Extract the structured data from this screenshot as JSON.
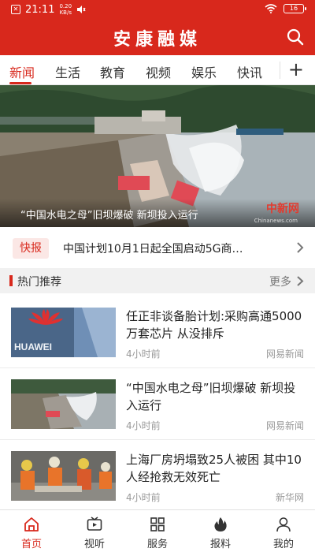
{
  "status_bar": {
    "time": "21:11",
    "net_speed_value": "0.20",
    "net_speed_unit": "KB/s",
    "battery": "16",
    "sim_icon": "sim-alert-icon",
    "icons": [
      "wifi-icon",
      "battery-icon",
      "mute-icon"
    ]
  },
  "header": {
    "title": "安康融媒",
    "search_icon": "search-icon",
    "color": "#d8281c"
  },
  "tabs": {
    "items": [
      {
        "label": "新闻",
        "active": true
      },
      {
        "label": "生活"
      },
      {
        "label": "教育"
      },
      {
        "label": "视频"
      },
      {
        "label": "娱乐"
      },
      {
        "label": "快讯"
      }
    ],
    "add_icon": "plus-icon"
  },
  "hero": {
    "caption": "“中国水电之母”旧坝爆破 新坝投入运行",
    "watermark": "中新网",
    "watermark_sub": "Chinanews.com"
  },
  "flash": {
    "badge": "快报",
    "text": "中国计划10月1日起全国启动5G商…"
  },
  "hot": {
    "title": "热门推荐",
    "more": "更多"
  },
  "news": [
    {
      "title": "任正非谈备胎计划:采购高通5000万套芯片 从没排斥",
      "time": "4小时前",
      "source": "网易新闻",
      "thumb_text": "HUAWEI"
    },
    {
      "title": "“中国水电之母”旧坝爆破 新坝投入运行",
      "time": "4小时前",
      "source": "网易新闻"
    },
    {
      "title": "上海厂房坍塌致25人被困 其中10人经抢救无效死亡",
      "time": "4小时前",
      "source": "新华网"
    }
  ],
  "bottom_nav": [
    {
      "label": "首页",
      "icon": "home-icon",
      "active": true
    },
    {
      "label": "视听",
      "icon": "tv-icon"
    },
    {
      "label": "服务",
      "icon": "grid-icon"
    },
    {
      "label": "报料",
      "icon": "fire-icon"
    },
    {
      "label": "我的",
      "icon": "user-icon"
    }
  ]
}
